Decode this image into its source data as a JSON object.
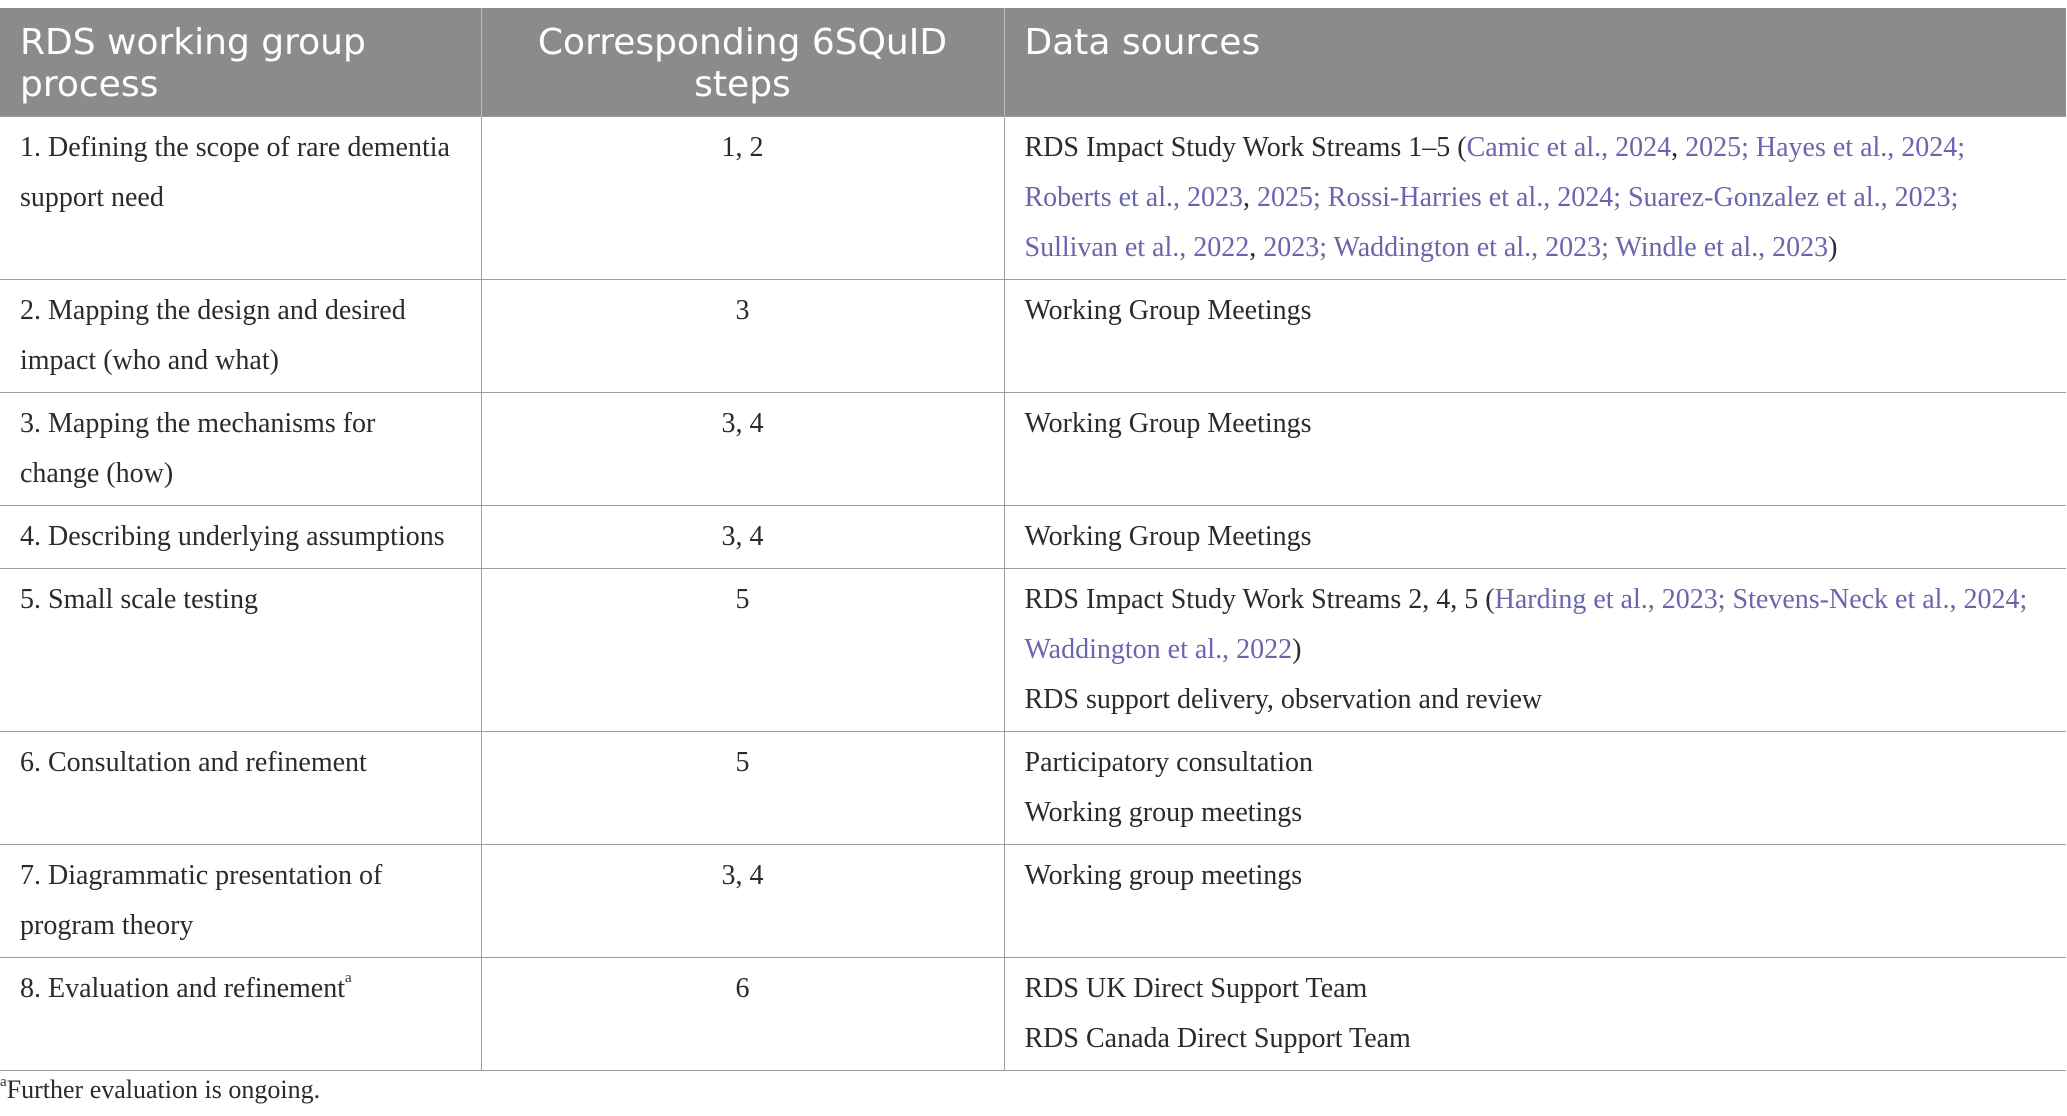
{
  "table": {
    "headers": {
      "col1": "RDS working group process",
      "col2": "Corresponding 6SQuID steps",
      "col3": "Data sources"
    },
    "rows": [
      {
        "process": "1. Defining the scope of rare dementia support need",
        "steps": "1, 2",
        "sources": {
          "pre": "RDS Impact Study Work Streams 1–5 (",
          "c1": "Camic et al., 2024",
          "s1": ", ",
          "c2": "2025; Hayes et al., 2024; Roberts et al., 2023",
          "s2": ", ",
          "c3": "2025; Rossi-Harries et al., 2024; Suarez-Gonzalez et al., 2023; Sullivan et al., 2022",
          "s3": ", ",
          "c4": "2023; Waddington et al., 2023; Windle et al., 2023",
          "post": ")"
        }
      },
      {
        "process": "2. Mapping the design and desired impact (who and what)",
        "steps": "3",
        "sources": [
          "Working Group Meetings"
        ]
      },
      {
        "process": "3. Mapping the mechanisms for change (how)",
        "steps": "3, 4",
        "sources": [
          "Working Group Meetings"
        ]
      },
      {
        "process": "4. Describing underlying assumptions",
        "steps": "3, 4",
        "sources": [
          "Working Group Meetings"
        ]
      },
      {
        "process": "5. Small scale testing",
        "steps": "5",
        "sources_cited": {
          "pre": "RDS Impact Study Work Streams 2, 4, 5 (",
          "cite": "Harding et al., 2023; Stevens-Neck et al., 2024; Waddington et al., 2022",
          "post": ")"
        },
        "sources": [
          "RDS support delivery, observation and review"
        ]
      },
      {
        "process": "6. Consultation and refinement",
        "steps": "5",
        "sources": [
          "Participatory consultation",
          "Working group meetings"
        ]
      },
      {
        "process": "7. Diagrammatic presentation of program theory",
        "steps": "3, 4",
        "sources": [
          "Working group meetings"
        ]
      },
      {
        "process": "8. Evaluation and refinement",
        "process_mark": "a",
        "steps": "6",
        "sources": [
          "RDS UK Direct Support Team",
          "RDS Canada Direct Support Team"
        ]
      }
    ]
  },
  "footnote": {
    "mark": "a",
    "text": "Further evaluation is ongoing."
  },
  "colors": {
    "header_bg": "#8a8c8b",
    "header_text": "#ffffff",
    "citation": "#6a66ad",
    "body_text": "#2b2b2b",
    "grid_line": "#9c9c9c"
  }
}
